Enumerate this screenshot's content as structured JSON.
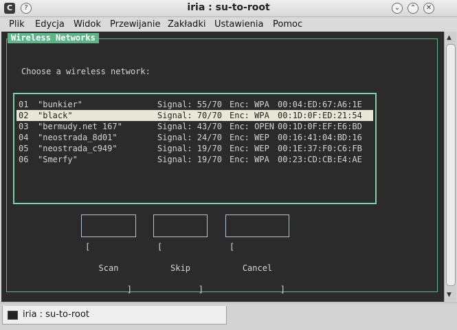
{
  "window": {
    "title": "iria : su-to-root"
  },
  "titlebar": {
    "app_icon": "konsole-icon",
    "help_glyph": "?",
    "minimize_glyph": "⌄",
    "maximize_glyph": "⌃",
    "close_glyph": "✕"
  },
  "menu": [
    "Plik",
    "Edycja",
    "Widok",
    "Przewijanie",
    "Zakładki",
    "Ustawienia",
    "Pomoc"
  ],
  "dialog": {
    "title": "Wireless Networks",
    "prompt": "Choose a wireless network:",
    "networks": [
      {
        "num": "01",
        "name": "\"bunkier\"",
        "signal": "Signal: 55/70",
        "enc": "Enc: WPA",
        "mac": "00:04:ED:67:A6:1E"
      },
      {
        "num": "02",
        "name": "\"black\"",
        "signal": "Signal: 70/70",
        "enc": "Enc: WPA",
        "mac": "00:1D:0F:ED:21:54"
      },
      {
        "num": "03",
        "name": "\"bermudy.net 167\"",
        "signal": "Signal: 43/70",
        "enc": "Enc: OPEN",
        "mac": "00:1D:0F:EF:E6:BD"
      },
      {
        "num": "04",
        "name": "\"neostrada_8d01\"",
        "signal": "Signal: 24/70",
        "enc": "Enc: WEP",
        "mac": "00:16:41:04:BD:16"
      },
      {
        "num": "05",
        "name": "\"neostrada_c949\"",
        "signal": "Signal: 19/70",
        "enc": "Enc: WEP",
        "mac": "00:1E:37:F0:C6:FB"
      },
      {
        "num": "06",
        "name": "\"Smerfy\"",
        "signal": "Signal: 19/70",
        "enc": "Enc: WPA",
        "mac": "00:23:CD:CB:E4:AE"
      }
    ],
    "selected_index": 1,
    "buttons": {
      "bracket_open": "[",
      "bracket_close": "]",
      "scan": "Scan",
      "skip": "Skip",
      "cancel": "Cancel"
    }
  },
  "tab": {
    "label": "iria : su-to-root",
    "icon": "terminal-icon"
  },
  "colors": {
    "accent": "#5fb58a",
    "terminal_bg": "#2b2b2b",
    "selection": "#e8e8d8"
  }
}
